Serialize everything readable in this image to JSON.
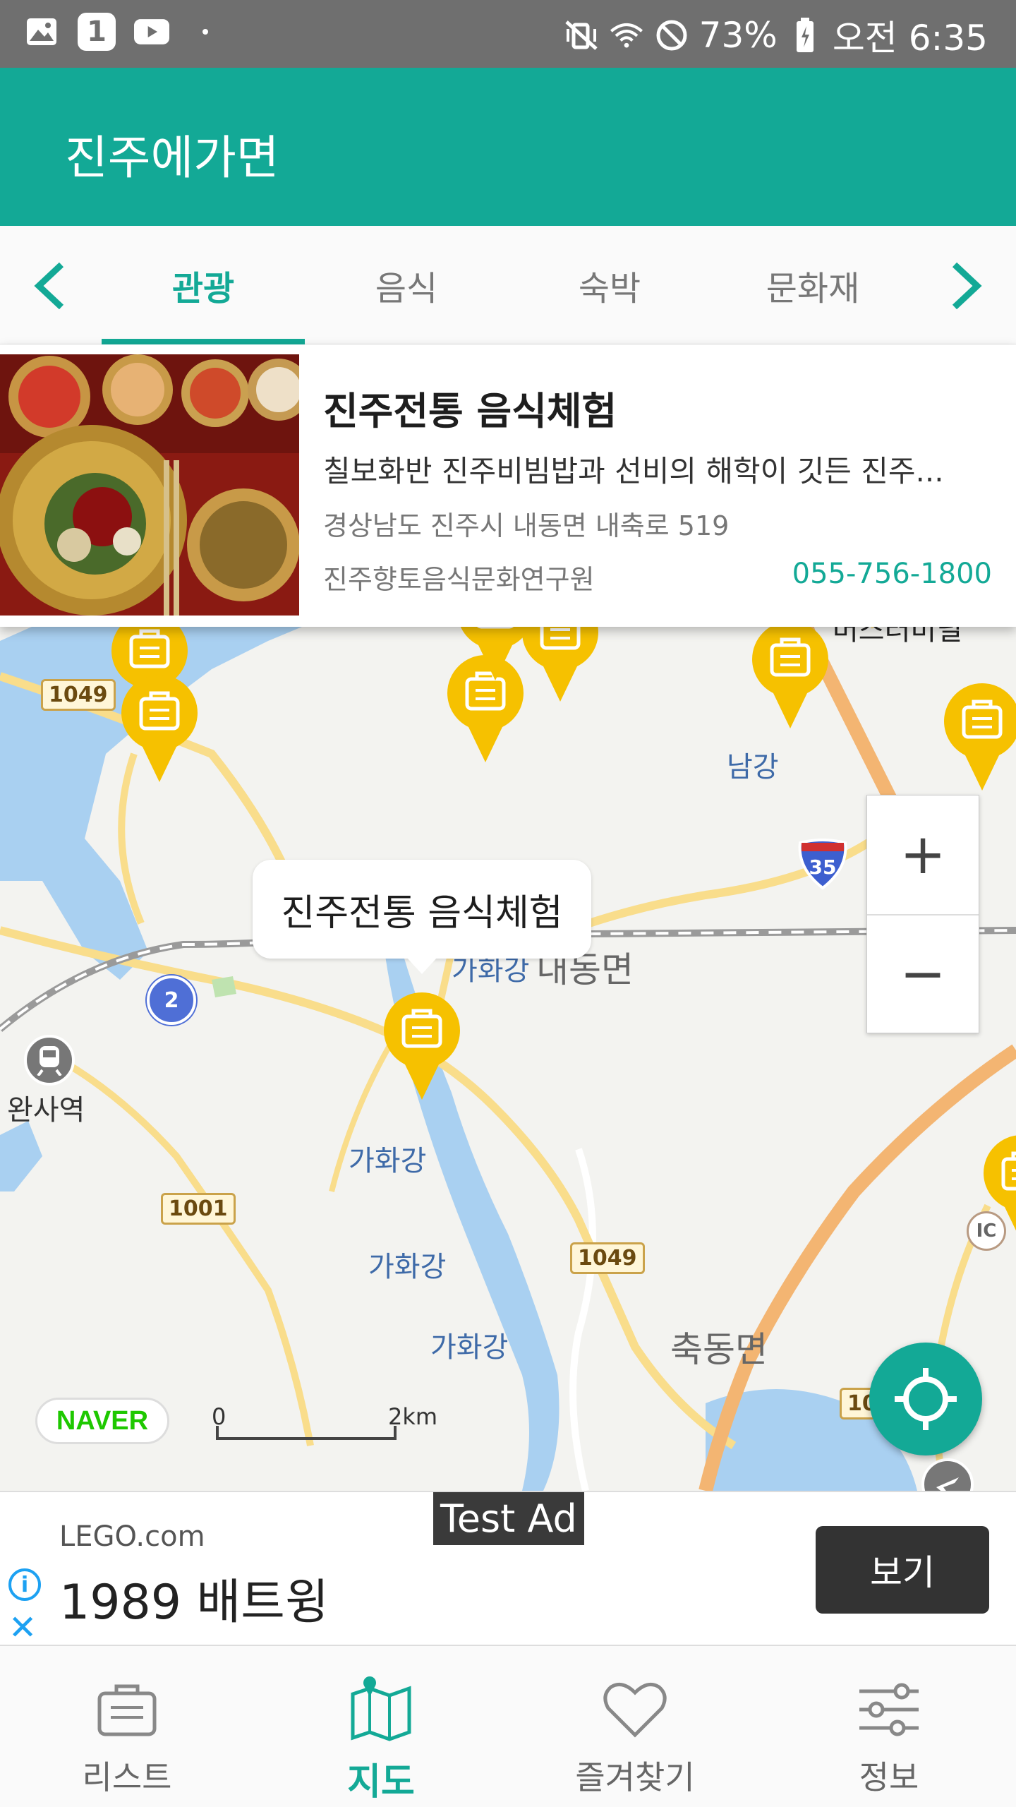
{
  "status_bar": {
    "battery": "73%",
    "time": "오전 6:35",
    "badge": "1",
    "icons": [
      "gallery-icon",
      "youtube-icon",
      "dot-icon",
      "mute-vibrate-icon",
      "wifi-icon",
      "block-icon",
      "battery-icon"
    ]
  },
  "app_bar": {
    "title": "진주에가면"
  },
  "tabs": {
    "items": [
      {
        "label": "관광",
        "active": true
      },
      {
        "label": "음식",
        "active": false
      },
      {
        "label": "숙박",
        "active": false
      },
      {
        "label": "문화재",
        "active": false
      }
    ]
  },
  "card": {
    "name": "진주전통 음식체험",
    "description": "칠보화반 진주비빔밥과 선비의 해학이 깃든 진주...",
    "address": "경상남도 진주시 내동면 내축로 519",
    "organization": "진주향토음식문화연구원",
    "phone": "055-756-1800"
  },
  "map": {
    "callout": "진주전통 음식체험",
    "labels": {
      "station": "완사역",
      "river_top": "남강",
      "river1": "가화강",
      "river2": "가화강",
      "river3": "가화강",
      "river4": "가화강",
      "district_naedong": "내동면",
      "district_chukdong": "축동면",
      "bus_terminal": "버스터미널",
      "ic": "IC"
    },
    "road_numbers": {
      "r1049a": "1049",
      "r1001": "1001",
      "r1049b": "1049",
      "r10": "10"
    },
    "shields": {
      "national": "2",
      "interstate": "35"
    },
    "zoom_in": "+",
    "zoom_out": "−",
    "naver": "NAVER",
    "scale_start": "0",
    "scale_end": "2km"
  },
  "ad": {
    "tag": "Test Ad",
    "domain": "LEGO.com",
    "headline": "1989 배트윙",
    "cta": "보기"
  },
  "bottom_nav": {
    "items": [
      {
        "label": "리스트",
        "icon": "briefcase-icon",
        "active": false
      },
      {
        "label": "지도",
        "icon": "map-icon",
        "active": true
      },
      {
        "label": "즐겨찾기",
        "icon": "heart-icon",
        "active": false
      },
      {
        "label": "정보",
        "icon": "settings-sliders-icon",
        "active": false
      }
    ]
  },
  "colors": {
    "primary": "#13a996",
    "pin": "#f6c100",
    "water": "#a9d0f1",
    "road": "#f9dd8b"
  }
}
